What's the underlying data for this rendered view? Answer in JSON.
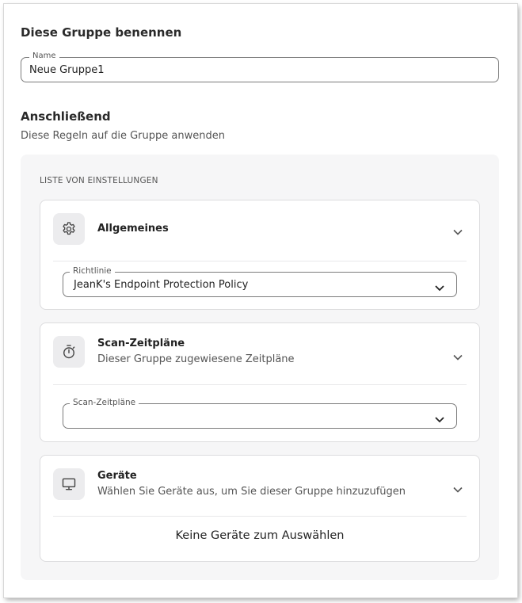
{
  "title": "Diese Gruppe benennen",
  "name_field": {
    "legend": "Name",
    "value": "Neue Gruppe1"
  },
  "subsection": {
    "title": "Anschließend",
    "description": "Diese Regeln auf die Gruppe anwenden"
  },
  "settings": {
    "label": "LISTE VON EINSTELLUNGEN",
    "general": {
      "title": "Allgemeines",
      "icon": "gear-icon",
      "policy": {
        "legend": "Richtlinie",
        "value": "JeanK's Endpoint Protection Policy"
      }
    },
    "schedules": {
      "title": "Scan-Zeitpläne",
      "description": "Dieser Gruppe zugewiesene Zeitpläne",
      "icon": "stopwatch-icon",
      "select": {
        "legend": "Scan-Zeitpläne",
        "value": ""
      }
    },
    "devices": {
      "title": "Geräte",
      "description": "Wählen Sie Geräte aus, um Sie dieser Gruppe hinzuzufügen",
      "icon": "monitor-icon",
      "empty_message": "Keine Geräte zum Auswählen"
    }
  }
}
